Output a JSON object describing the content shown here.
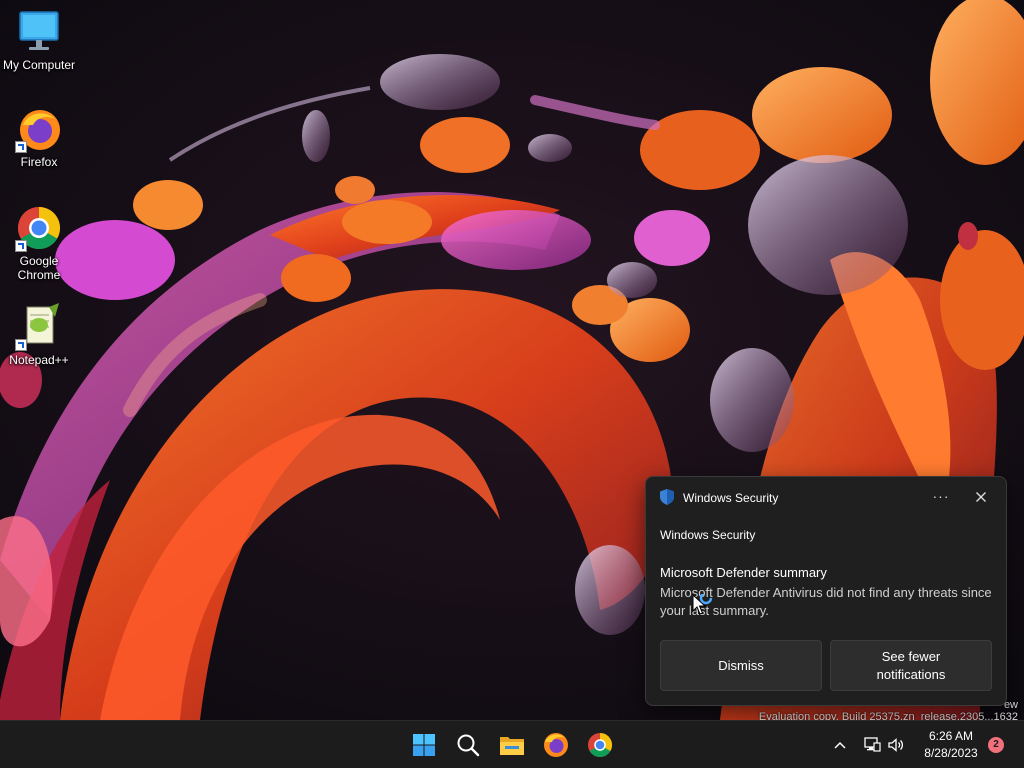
{
  "desktop": {
    "icons": [
      {
        "label": "My Computer",
        "icon": "monitor-icon"
      },
      {
        "label": "Firefox",
        "icon": "firefox-icon"
      },
      {
        "label": "Google Chrome",
        "icon": "chrome-icon"
      },
      {
        "label": "Notepad++",
        "icon": "notepadpp-icon"
      }
    ],
    "watermark_line1": "ew",
    "watermark_line2": "Evaluation copy. Build 25375.zn_release.2305...1632"
  },
  "toast": {
    "app_name": "Windows Security",
    "more_label": "···",
    "subheading": "Windows Security",
    "title": "Microsoft Defender summary",
    "body": "Microsoft Defender Antivirus did not find any threats since your last summary.",
    "dismiss_label": "Dismiss",
    "fewer_label": "See fewer notifications"
  },
  "taskbar": {
    "apps": [
      "start-icon",
      "search-icon",
      "file-explorer-icon",
      "firefox-icon",
      "chrome-icon"
    ],
    "tray": [
      "chevron-up-icon",
      "network-icon",
      "volume-icon"
    ],
    "time": "6:26 AM",
    "date": "8/28/2023",
    "notification_count": "2"
  },
  "colors": {
    "accent_blue": "#0078d4",
    "taskbar_bg": "#1c1c1c",
    "toast_bg": "#1f1f1f",
    "badge": "#f1707b"
  }
}
